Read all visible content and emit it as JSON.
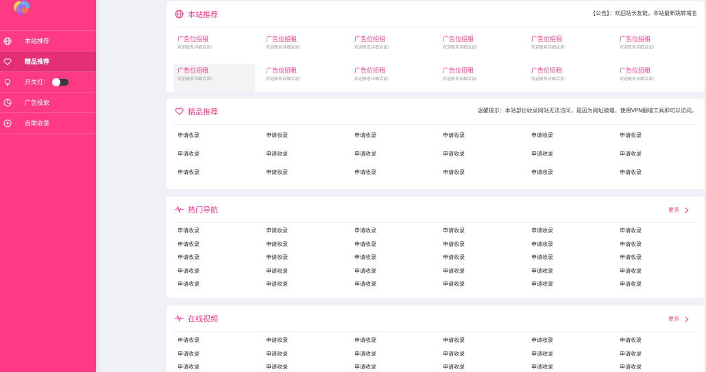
{
  "colors": {
    "accent": "#ff3a84",
    "sidebar": "#ff3a84",
    "background": "#f0f1f6"
  },
  "sidebar": {
    "items": [
      {
        "label": "本站推荐",
        "icon": "globe-icon",
        "active": false
      },
      {
        "label": "精品推荐",
        "icon": "heart-icon",
        "active": true
      },
      {
        "label": "开关灯：",
        "icon": "bulb-icon",
        "active": false,
        "toggle": true
      },
      {
        "label": "广告投放",
        "icon": "pie-chart-icon",
        "active": false
      },
      {
        "label": "自助收录",
        "icon": "plus-circle-icon",
        "active": false
      }
    ]
  },
  "recommend": {
    "title": "本站推荐",
    "notice": "【公告】：欢迎站长友链，本站最新跳转域名",
    "ads": [
      {
        "title": "广告位招租",
        "sub": "欢迎联系详细洽谈!"
      },
      {
        "title": "广告位招租",
        "sub": "欢迎联系详细洽谈!"
      },
      {
        "title": "广告位招租",
        "sub": "欢迎联系详细洽谈!"
      },
      {
        "title": "广告位招租",
        "sub": "欢迎联系详细洽谈!"
      },
      {
        "title": "广告位招租",
        "sub": "欢迎联系详细洽谈!"
      },
      {
        "title": "广告位招租",
        "sub": "欢迎联系详细洽谈!"
      },
      {
        "title": "广告位招租",
        "sub": "欢迎联系详细洽谈!"
      },
      {
        "title": "广告位招租",
        "sub": "欢迎联系详细洽谈!"
      },
      {
        "title": "广告位招租",
        "sub": "欢迎联系详细洽谈!"
      },
      {
        "title": "广告位招租",
        "sub": "欢迎联系详细洽谈!"
      },
      {
        "title": "广告位招租",
        "sub": "欢迎联系详细洽谈!"
      },
      {
        "title": "广告位招租",
        "sub": "欢迎联系详细洽谈!"
      }
    ]
  },
  "premium": {
    "title": "精品推荐",
    "tip": "温馨提示：本站部份收录网站无法访问，是因为网址被墙，使用VPN翻墙工具即可以访问。",
    "links": [
      "申请收录",
      "申请收录",
      "申请收录",
      "申请收录",
      "申请收录",
      "申请收录",
      "申请收录",
      "申请收录",
      "申请收录",
      "申请收录",
      "申请收录",
      "申请收录",
      "申请收录",
      "申请收录",
      "申请收录",
      "申请收录",
      "申请收录",
      "申请收录"
    ]
  },
  "hot_nav": {
    "title": "热门导航",
    "more": "更多",
    "links": [
      "申请收录",
      "申请收录",
      "申请收录",
      "申请收录",
      "申请收录",
      "申请收录",
      "申请收录",
      "申请收录",
      "申请收录",
      "申请收录",
      "申请收录",
      "申请收录",
      "申请收录",
      "申请收录",
      "申请收录",
      "申请收录",
      "申请收录",
      "申请收录",
      "申请收录",
      "申请收录",
      "申请收录",
      "申请收录",
      "申请收录",
      "申请收录",
      "申请收录",
      "申请收录",
      "申请收录",
      "申请收录",
      "申请收录",
      "申请收录"
    ]
  },
  "online_video": {
    "title": "在线视频",
    "more": "更多",
    "links": [
      "申请收录",
      "申请收录",
      "申请收录",
      "申请收录",
      "申请收录",
      "申请收录",
      "申请收录",
      "申请收录",
      "申请收录",
      "申请收录",
      "申请收录",
      "申请收录",
      "申请收录",
      "申请收录",
      "申请收录",
      "申请收录",
      "申请收录",
      "申请收录"
    ]
  }
}
